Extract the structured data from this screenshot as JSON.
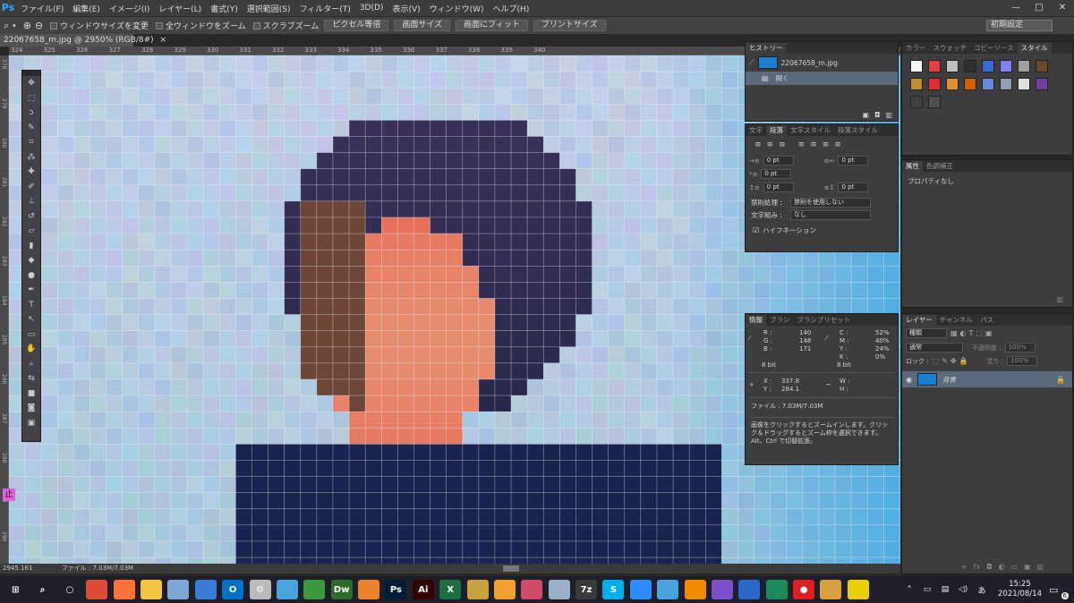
{
  "app": {
    "logo": "Ps"
  },
  "menu": [
    "ファイル(F)",
    "編集(E)",
    "イメージ(I)",
    "レイヤー(L)",
    "書式(Y)",
    "選択範囲(S)",
    "フィルター(T)",
    "3D(D)",
    "表示(V)",
    "ウィンドウ(W)",
    "ヘルプ(H)"
  ],
  "window_controls": {
    "minimize": "—",
    "maximize": "□",
    "close": "✕"
  },
  "options": {
    "zoom_icon": "zoom-icon",
    "checks": [
      {
        "label": "ウィンドウサイズを変更",
        "checked": false
      },
      {
        "label": "全ウィンドウをズーム",
        "checked": false
      },
      {
        "label": "スクラブズーム",
        "checked": false
      }
    ],
    "buttons": [
      "ピクセル等倍",
      "画面サイズ",
      "画面にフィット",
      "プリントサイズ"
    ],
    "workspace": "初期設定"
  },
  "document": {
    "tab": "22067658_m.jpg @ 2950% (RGB/8#)",
    "close": "×"
  },
  "ruler": {
    "top": [
      "324",
      "325",
      "326",
      "327",
      "328",
      "329",
      "330",
      "331",
      "332",
      "333",
      "334",
      "335",
      "336",
      "337",
      "338",
      "339",
      "340"
    ],
    "left": [
      "278",
      "279",
      "280",
      "281",
      "282",
      "283",
      "284",
      "285",
      "286",
      "287",
      "288",
      "289",
      "290"
    ]
  },
  "status": {
    "zoom": "2945.161",
    "file": "ファイル : 7.03M/7.03M"
  },
  "history": {
    "tab": "ヒストリー",
    "snapshot": "22067658_m.jpg",
    "state": "開く"
  },
  "paragraph": {
    "tabs": [
      "文字",
      "段落",
      "文字スタイル",
      "段落スタイル"
    ],
    "indent_left": "0 pt",
    "indent_right": "0 pt",
    "first_line": "0 pt",
    "space_before": "0 pt",
    "space_after": "0 pt",
    "kinsoku_label": "禁則処理 :",
    "kinsoku_value": "禁則を使用しない",
    "mojigumi_label": "文字組み :",
    "mojigumi_value": "なし",
    "hyphenation": "ハイフネーション"
  },
  "info": {
    "tabs": [
      "情報",
      "ブラシ",
      "ブラシプリセット"
    ],
    "R": "140",
    "G": "148",
    "B": "171",
    "bit1": "8 bit",
    "C": "52%",
    "M": "40%",
    "Y": "24%",
    "K": "0%",
    "bit2": "8 bit",
    "X": "337.8",
    "Y2": "284.1",
    "W": "",
    "H": "",
    "file": "ファイル : 7.03M/7.03M",
    "help": "画像をクリックするとズームインします。クリック＆ドラッグするとズーム枠を選択できます。Alt、Ctrl で切替拡張。"
  },
  "styles_panel": {
    "tabs": [
      "カラー",
      "スウォッチ",
      "コピーソース",
      "スタイル"
    ]
  },
  "properties": {
    "tabs": [
      "属性",
      "色調補正"
    ],
    "text": "プロパティなし"
  },
  "layers": {
    "tabs": [
      "レイヤー",
      "チャンネル",
      "パス"
    ],
    "kind": "種類",
    "blend": "通常",
    "opacity_label": "不透明度 :",
    "opacity": "100%",
    "lock_label": "ロック :",
    "fill_label": "塗り :",
    "fill": "100%",
    "layer_name": "背景"
  },
  "taskbar": {
    "time": "15:25",
    "date": "2021/08/14",
    "ime": "あ",
    "notifications": "6",
    "apps": [
      {
        "name": "windows-start-icon",
        "c": "#ffffff",
        "t": "⊞"
      },
      {
        "name": "search-icon",
        "c": "#ffffff",
        "t": "⌕"
      },
      {
        "name": "cortana-icon",
        "c": "#ffffff",
        "t": "○"
      },
      {
        "name": "chrome-icon",
        "c": "#dd4b39",
        "t": ""
      },
      {
        "name": "firefox-icon",
        "c": "#ff7139",
        "t": ""
      },
      {
        "name": "explorer-icon",
        "c": "#f4c542",
        "t": ""
      },
      {
        "name": "app-icon-1",
        "c": "#7fa6d6",
        "t": ""
      },
      {
        "name": "photos-icon",
        "c": "#3a7bd5",
        "t": ""
      },
      {
        "name": "outlook-icon",
        "c": "#0072c6",
        "t": "O"
      },
      {
        "name": "settings-icon",
        "c": "#bbbbbb",
        "t": "⚙"
      },
      {
        "name": "app-icon-2",
        "c": "#4aa3df",
        "t": ""
      },
      {
        "name": "app-icon-3",
        "c": "#3b9a3b",
        "t": ""
      },
      {
        "name": "dreamweaver-icon",
        "c": "#2d6b2d",
        "t": "Dw"
      },
      {
        "name": "app-icon-4",
        "c": "#e9832e",
        "t": ""
      },
      {
        "name": "photoshop-icon",
        "c": "#001d34",
        "t": "Ps"
      },
      {
        "name": "illustrator-icon",
        "c": "#330000",
        "t": "Ai"
      },
      {
        "name": "excel-icon",
        "c": "#1d6f42",
        "t": "X"
      },
      {
        "name": "app-icon-5",
        "c": "#c8a23c",
        "t": ""
      },
      {
        "name": "butterfly-icon",
        "c": "#f0a030",
        "t": ""
      },
      {
        "name": "app-icon-6",
        "c": "#d04a6a",
        "t": ""
      },
      {
        "name": "app-icon-7",
        "c": "#9ab0c8",
        "t": ""
      },
      {
        "name": "7zip-icon",
        "c": "#3a3a3a",
        "t": "7z"
      },
      {
        "name": "skype-icon",
        "c": "#00aff0",
        "t": "S"
      },
      {
        "name": "zoom-app-icon",
        "c": "#2d8cff",
        "t": ""
      },
      {
        "name": "app-icon-8",
        "c": "#4aa3df",
        "t": ""
      },
      {
        "name": "vlc-icon",
        "c": "#f08a00",
        "t": ""
      },
      {
        "name": "app-icon-9",
        "c": "#7b4fc9",
        "t": ""
      },
      {
        "name": "app-icon-10",
        "c": "#2c68c9",
        "t": ""
      },
      {
        "name": "app-icon-11",
        "c": "#1e8a5a",
        "t": ""
      },
      {
        "name": "record-icon",
        "c": "#e02020",
        "t": "●"
      },
      {
        "name": "app-icon-12",
        "c": "#d8a040",
        "t": ""
      },
      {
        "name": "app-icon-13",
        "c": "#e8d000",
        "t": ""
      }
    ]
  },
  "tools": [
    "move-icon",
    "marquee-icon",
    "lasso-icon",
    "quick-select-icon",
    "crop-icon",
    "eyedropper-icon",
    "healing-icon",
    "brush-icon",
    "stamp-icon",
    "history-brush-icon",
    "eraser-icon",
    "gradient-icon",
    "blur-icon",
    "dodge-icon",
    "pen-icon",
    "type-icon",
    "path-select-icon",
    "shape-icon",
    "hand-icon",
    "zoom-tool-icon",
    "swap-colors-icon",
    "color-swatch-icon",
    "quickmask-icon",
    "screen-mode-icon"
  ],
  "tool_glyphs": [
    "✥",
    "⬚",
    "ↄ",
    "✎",
    "⌗",
    "⁂",
    "✚",
    "✐",
    "⊥",
    "↺",
    "▱",
    "▮",
    "◆",
    "●",
    "✒",
    "T",
    "↖",
    "▭",
    "✋",
    "⌕",
    "⇆",
    "■",
    "◙",
    "▣"
  ],
  "float_badge": "止"
}
